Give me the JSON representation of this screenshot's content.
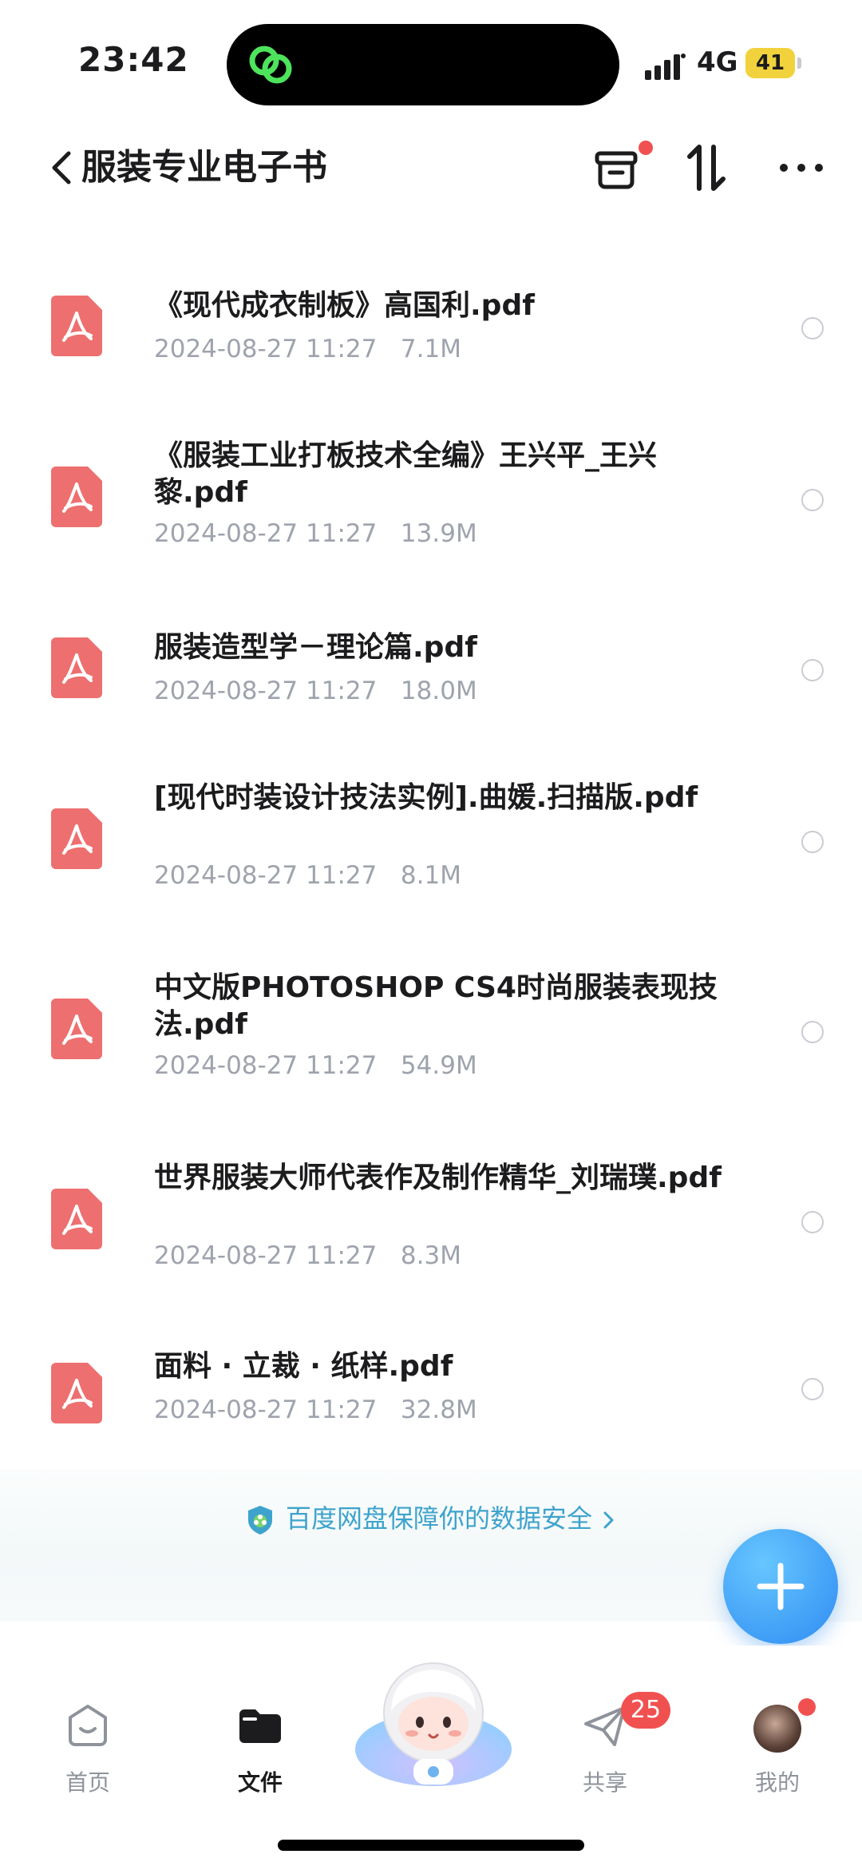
{
  "status_bar": {
    "time": "23:42",
    "network": "4G",
    "battery": "41",
    "island_icon": "link-rings-icon"
  },
  "header": {
    "title": "服装专业电子书",
    "back_icon": "chevron-left-icon",
    "icons": [
      "archive-box-icon",
      "sort-icon",
      "more-dots-icon"
    ]
  },
  "files": [
    {
      "name": "《现代成衣制板》高国利.pdf",
      "date": "2024-08-27 11:27",
      "size": "7.1M"
    },
    {
      "name": "《服装工业打板技术全编》王兴平_王兴黎.pdf",
      "date": "2024-08-27 11:27",
      "size": "13.9M"
    },
    {
      "name": "服装造型学－理论篇.pdf",
      "date": "2024-08-27 11:27",
      "size": "18.0M"
    },
    {
      "name": "[现代时装设计技法实例].曲媛.扫描版.pdf",
      "date": "2024-08-27 11:27",
      "size": "8.1M"
    },
    {
      "name": "中文版PHOTOSHOP CS4时尚服装表现技法.pdf",
      "date": "2024-08-27 11:27",
      "size": "54.9M"
    },
    {
      "name": "世界服装大师代表作及制作精华_刘瑞璞.pdf",
      "date": "2024-08-27 11:27",
      "size": "8.3M"
    },
    {
      "name": "面料 · 立裁 · 纸样.pdf",
      "date": "2024-08-27 11:27",
      "size": "32.8M"
    }
  ],
  "security_notice": "百度网盘保障你的数据安全",
  "bottom_nav": {
    "home": "首页",
    "files": "文件",
    "share": "共享",
    "share_badge": "25",
    "mine": "我的"
  },
  "colors": {
    "accent": "#3ea3cc",
    "pdf_icon": "#ee6f6f",
    "badge": "#f05150",
    "fab": "#2f8cf2"
  }
}
